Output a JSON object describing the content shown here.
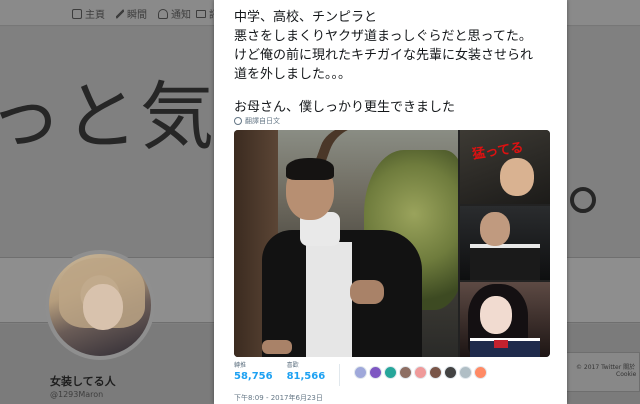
{
  "background": {
    "nav": {
      "home": "主頁",
      "moments": "瞬間",
      "notifications": "通知",
      "messages": "訊息"
    },
    "banner_text": "っと気にな",
    "profile": {
      "name": "女装してる人",
      "handle": "@1293Maron"
    },
    "footer": {
      "copyright": "© 2017 Twitter",
      "about": "關於",
      "cookies": "Cookie"
    }
  },
  "tweet": {
    "lines": [
      "中学、高校、チンピラと",
      "悪さをしまくりヤクザ道まっしぐらだと思ってた。",
      "けど俺の前に現れたキチガイな先輩に女装させられ",
      "道を外しました。。。"
    ],
    "closing": "お母さん、僕しっかり更生できました",
    "translate_label": "翻譯自日文",
    "photo_stamp": "猛ってる",
    "stats": {
      "retweets_label": "轉推",
      "retweets": "58,756",
      "likes_label": "喜歡",
      "likes": "81,566"
    },
    "liker_colors": [
      "#9fa8da",
      "#7e57c2",
      "#26a69a",
      "#8d6e63",
      "#ef9a9a",
      "#795548",
      "#424242",
      "#b0bec5",
      "#ff8a65"
    ],
    "timestamp": "下午8:09 - 2017年6月23日"
  }
}
